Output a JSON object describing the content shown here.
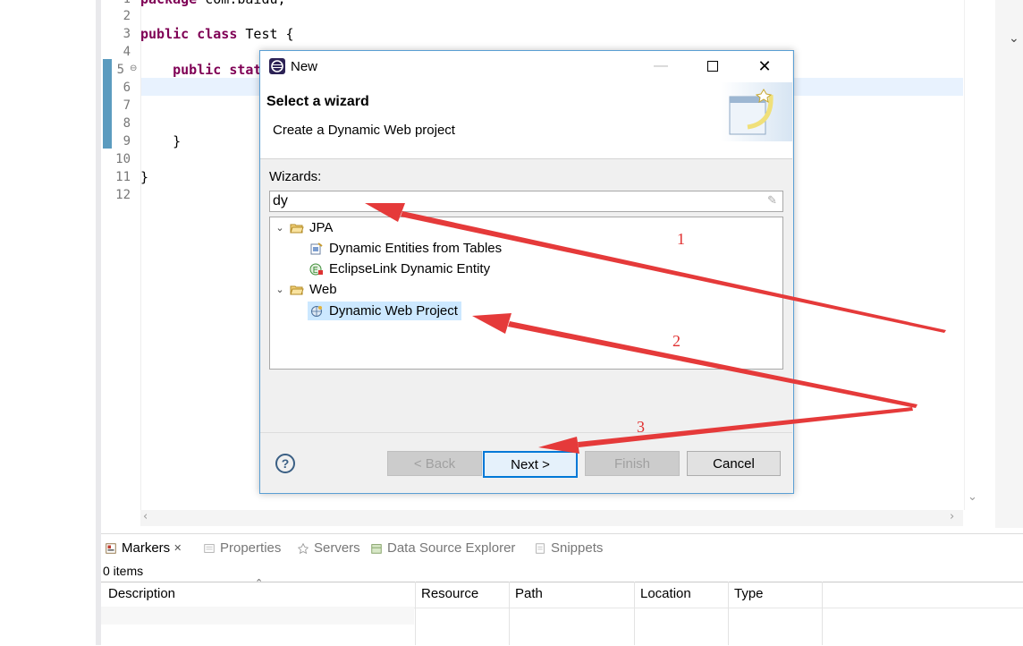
{
  "editor": {
    "lines": [
      {
        "no": "1",
        "text": "package com.baidu;"
      },
      {
        "no": "2",
        "text": ""
      },
      {
        "no": "3",
        "text": "public class Test {"
      },
      {
        "no": "4",
        "text": ""
      },
      {
        "no": "5",
        "text": "    public stat"
      },
      {
        "no": "6",
        "text": ""
      },
      {
        "no": "7",
        "text": ""
      },
      {
        "no": "8",
        "text": ""
      },
      {
        "no": "9",
        "text": "    }"
      },
      {
        "no": "10",
        "text": ""
      },
      {
        "no": "11",
        "text": "}"
      },
      {
        "no": "12",
        "text": ""
      }
    ]
  },
  "dialog": {
    "title": "New",
    "header_title": "Select a wizard",
    "header_desc": "Create a Dynamic Web project",
    "wizards_label": "Wizards:",
    "filter_value": "dy",
    "tree": [
      {
        "label": "JPA",
        "type": "folder"
      },
      {
        "label": "Dynamic Entities from Tables",
        "type": "item"
      },
      {
        "label": "EclipseLink Dynamic Entity",
        "type": "item"
      },
      {
        "label": "Web",
        "type": "folder"
      },
      {
        "label": "Dynamic Web Project",
        "type": "item",
        "selected": true
      }
    ],
    "buttons": {
      "back": "< Back",
      "next": "Next >",
      "finish": "Finish",
      "cancel": "Cancel"
    },
    "help": "?"
  },
  "panel": {
    "tabs": [
      "Markers",
      "Properties",
      "Servers",
      "Data Source Explorer",
      "Snippets"
    ],
    "active_tab_close": "✕",
    "items_count": "0 items",
    "columns": [
      "Description",
      "Resource",
      "Path",
      "Location",
      "Type"
    ]
  },
  "annotations": [
    "1",
    "2",
    "3"
  ],
  "colors": {
    "accent": "#0078d7",
    "annotation": "#e03030",
    "keyword": "#7f0055",
    "selection": "#cce8ff"
  }
}
